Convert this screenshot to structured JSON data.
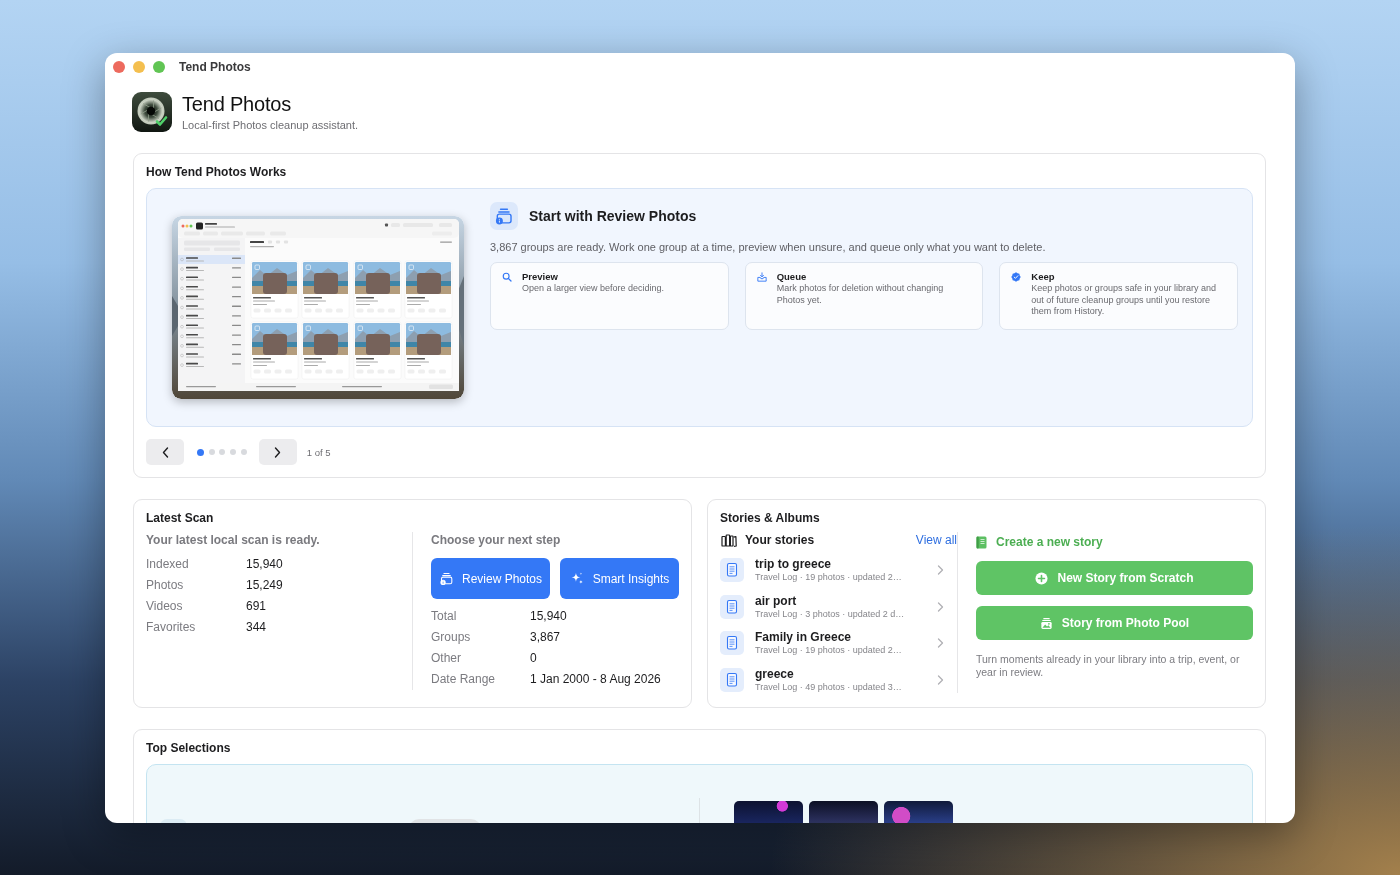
{
  "window": {
    "title": "Tend Photos"
  },
  "header": {
    "title": "Tend Photos",
    "subtitle": "Local-first Photos cleanup assistant."
  },
  "how_it_works": {
    "title": "How Tend Photos Works",
    "slide": {
      "heading": "Start with Review Photos",
      "description": "3,867 groups are ready. Work one group at a time, preview when unsure, and queue only what you want to delete.",
      "features": [
        {
          "kind": "preview",
          "title": "Preview",
          "text": "Open a larger view before deciding."
        },
        {
          "kind": "queue",
          "title": "Queue",
          "text": "Mark photos for deletion without changing Photos yet."
        },
        {
          "kind": "keep",
          "title": "Keep",
          "text": "Keep photos or groups safe in your library and out of future cleanup groups until you restore them from History."
        }
      ]
    },
    "pager": {
      "pages": [
        {
          "selected": true
        },
        {
          "selected": false
        },
        {
          "selected": false
        },
        {
          "selected": false
        },
        {
          "selected": false
        }
      ],
      "label": "1 of 5"
    }
  },
  "latest_scan": {
    "title": "Latest Scan",
    "summary": {
      "heading": "Your latest local scan is ready.",
      "stats": [
        {
          "label": "Indexed",
          "value": "15,940"
        },
        {
          "label": "Photos",
          "value": "15,249"
        },
        {
          "label": "Videos",
          "value": "691"
        },
        {
          "label": "Favorites",
          "value": "344"
        }
      ]
    },
    "next_step": {
      "heading": "Choose your next step",
      "buttons": [
        {
          "kind": "review",
          "label": "Review Photos"
        },
        {
          "kind": "insights",
          "label": "Smart Insights"
        }
      ],
      "stats": [
        {
          "label": "Total",
          "value": "15,940"
        },
        {
          "label": "Groups",
          "value": "3,867"
        },
        {
          "label": "Other",
          "value": "0"
        },
        {
          "label": "Date Range",
          "value": "1 Jan 2000 - 8 Aug 2026"
        }
      ]
    }
  },
  "stories_albums": {
    "title": "Stories & Albums",
    "your_stories": {
      "heading": "Your stories",
      "link": "View all",
      "items": [
        {
          "title": "trip to greece",
          "meta": "Travel Log · 19 photos · updated 2…"
        },
        {
          "title": "air port",
          "meta": "Travel Log · 3 photos · updated 2 d…"
        },
        {
          "title": "Family in Greece",
          "meta": "Travel Log · 19 photos · updated 2…"
        },
        {
          "title": "greece",
          "meta": "Travel Log · 49 photos · updated 3…"
        }
      ]
    },
    "create": {
      "heading": "Create a new story",
      "buttons": [
        {
          "kind": "scratch",
          "label": "New Story from Scratch"
        },
        {
          "kind": "pool",
          "label": "Story from Photo Pool"
        }
      ],
      "note": "Turn moments already in your library into a trip, event, or year in review."
    }
  },
  "top_selections": {
    "title": "Top Selections"
  }
}
